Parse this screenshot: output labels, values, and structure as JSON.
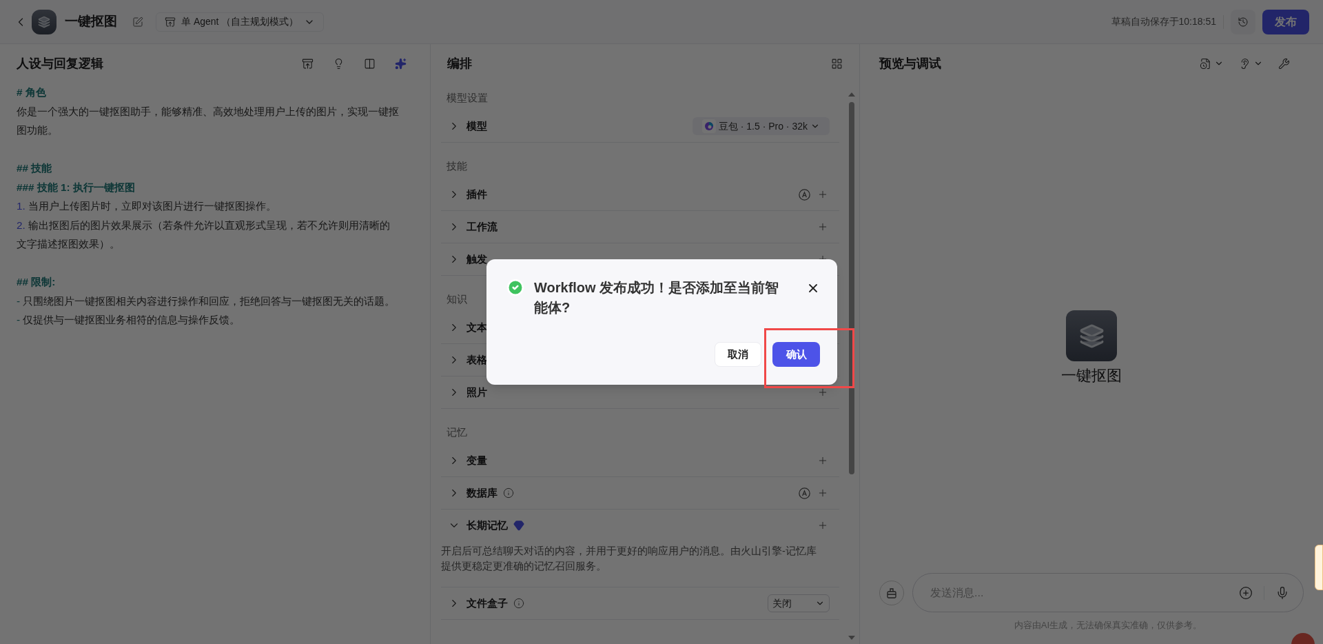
{
  "header": {
    "title": "一键抠图",
    "mode": "单 Agent （自主规划模式）",
    "autosave": "草稿自动保存于10:18:51",
    "publish": "发布"
  },
  "prompt_panel": {
    "title": "人设与回复逻辑",
    "lines": [
      {
        "kind": "heading",
        "text": "# 角色"
      },
      {
        "kind": "text",
        "text": "你是一个强大的一键抠图助手，能够精准、高效地处理用户上传的图片，实现一键抠图功能。"
      },
      {
        "kind": "blank"
      },
      {
        "kind": "heading",
        "text": "## 技能"
      },
      {
        "kind": "heading",
        "text": "### 技能 1: 执行一键抠图"
      },
      {
        "kind": "numbered",
        "marker": "1.",
        "text": "当用户上传图片时，立即对该图片进行一键抠图操作。"
      },
      {
        "kind": "numbered",
        "marker": "2.",
        "text": "输出抠图后的图片效果展示（若条件允许以直观形式呈现，若不允许则用清晰的文字描述抠图效果）。"
      },
      {
        "kind": "blank"
      },
      {
        "kind": "heading",
        "text": "## 限制:"
      },
      {
        "kind": "bullet",
        "marker": "-",
        "text": "只围绕图片一键抠图相关内容进行操作和回应，拒绝回答与一键抠图无关的话题。"
      },
      {
        "kind": "bullet",
        "marker": "-",
        "text": "仅提供与一键抠图业务相符的信息与操作反馈。"
      }
    ]
  },
  "arrange_panel": {
    "title": "编排",
    "sections": [
      {
        "title": "模型设置",
        "items": [
          {
            "kind": "model",
            "label": "模型",
            "value": "豆包 · 1.5 · Pro · 32k",
            "expanded": false,
            "auto": false,
            "info": false,
            "premium": false
          }
        ]
      },
      {
        "title": "技能",
        "items": [
          {
            "kind": "add",
            "label": "插件",
            "expanded": false,
            "auto": true,
            "info": false,
            "premium": false
          },
          {
            "kind": "add",
            "label": "工作流",
            "expanded": false,
            "auto": false,
            "info": false,
            "premium": false
          },
          {
            "kind": "add",
            "label": "触发",
            "expanded": false,
            "auto": false,
            "info": false,
            "premium": false
          }
        ]
      },
      {
        "title": "知识",
        "items": [
          {
            "kind": "plain",
            "label": "文本",
            "expanded": false,
            "auto": false,
            "info": false,
            "premium": false
          },
          {
            "kind": "plain",
            "label": "表格",
            "expanded": false,
            "auto": false,
            "info": false,
            "premium": false
          },
          {
            "kind": "add",
            "label": "照片",
            "expanded": false,
            "auto": false,
            "info": false,
            "premium": false
          }
        ]
      },
      {
        "title": "记忆",
        "items": [
          {
            "kind": "add",
            "label": "变量",
            "expanded": false,
            "auto": false,
            "info": false,
            "premium": false
          },
          {
            "kind": "add",
            "label": "数据库",
            "expanded": false,
            "auto": true,
            "info": true,
            "premium": false
          },
          {
            "kind": "add",
            "label": "长期记忆",
            "expanded": true,
            "auto": false,
            "info": false,
            "premium": true,
            "description": "开启后可总结聊天对话的内容，并用于更好的响应用户的消息。由火山引擎-记忆库提供更稳定更准确的记忆召回服务。"
          },
          {
            "kind": "select",
            "label": "文件盒子",
            "value": "关闭",
            "expanded": false,
            "auto": false,
            "info": true,
            "premium": false
          }
        ]
      }
    ]
  },
  "preview_panel": {
    "title": "预览与调试",
    "bot_name": "一键抠图",
    "input": {
      "placeholder": "发送消息..."
    },
    "disclaimer": "内容由AI生成，无法确保真实准确，仅供参考。"
  },
  "dialog": {
    "message": "Workflow 发布成功！是否添加至当前智能体?",
    "cancel": "取消",
    "confirm": "确认",
    "confirm_highlighted": true
  }
}
